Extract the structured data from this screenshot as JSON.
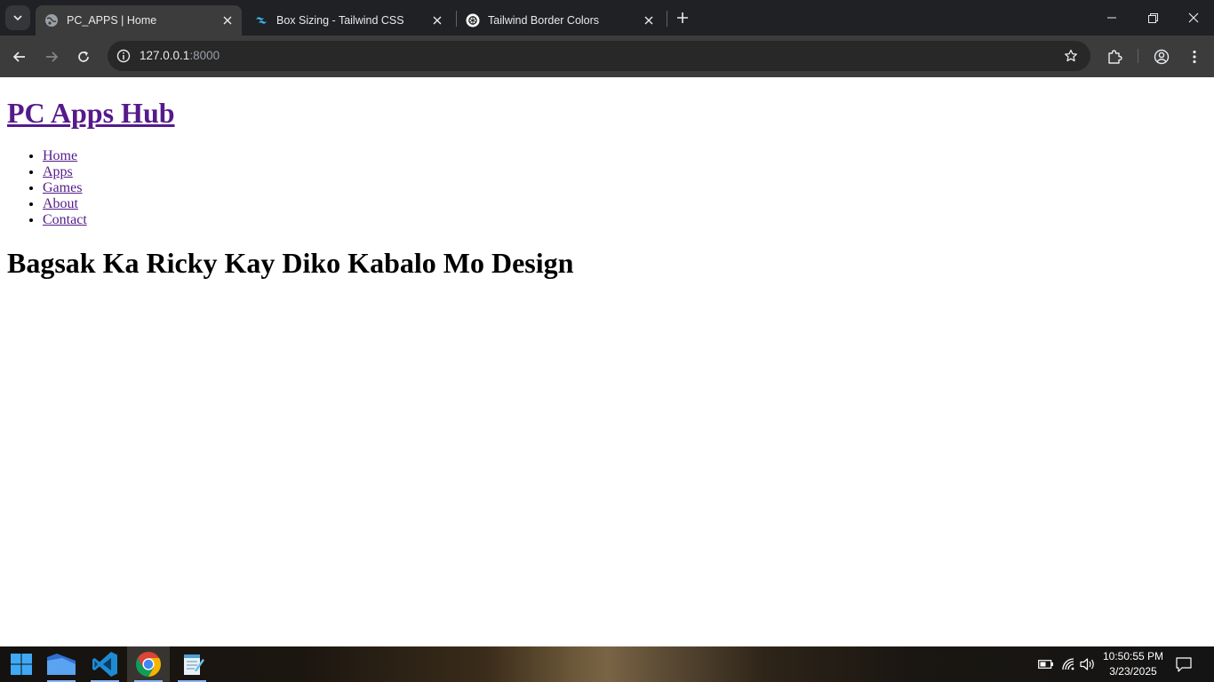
{
  "browser": {
    "tabs": [
      {
        "title": "PC_APPS | Home",
        "favicon": "globe-icon",
        "active": true
      },
      {
        "title": "Box Sizing - Tailwind CSS",
        "favicon": "tailwind-icon",
        "active": false
      },
      {
        "title": "Tailwind Border Colors",
        "favicon": "openai-icon",
        "active": false
      }
    ],
    "url_host": "127.0.0.1",
    "url_port": ":8000"
  },
  "page": {
    "site_title": "PC Apps Hub",
    "nav": [
      "Home",
      "Apps",
      "Games",
      "About",
      "Contact"
    ],
    "heading": "Bagsak Ka Ricky Kay Diko Kabalo Mo Design"
  },
  "taskbar": {
    "apps": [
      "start-icon",
      "files-icon",
      "vscode-icon",
      "chrome-icon",
      "notepad-icon"
    ],
    "active_app": "chrome-icon",
    "time": "10:50:55 PM",
    "date": "3/23/2025"
  },
  "colors": {
    "visited_link": "#551a8b",
    "tabstrip_bg": "#202124",
    "toolbar_bg": "#3c3c3c",
    "omnibox_bg": "#282828"
  }
}
